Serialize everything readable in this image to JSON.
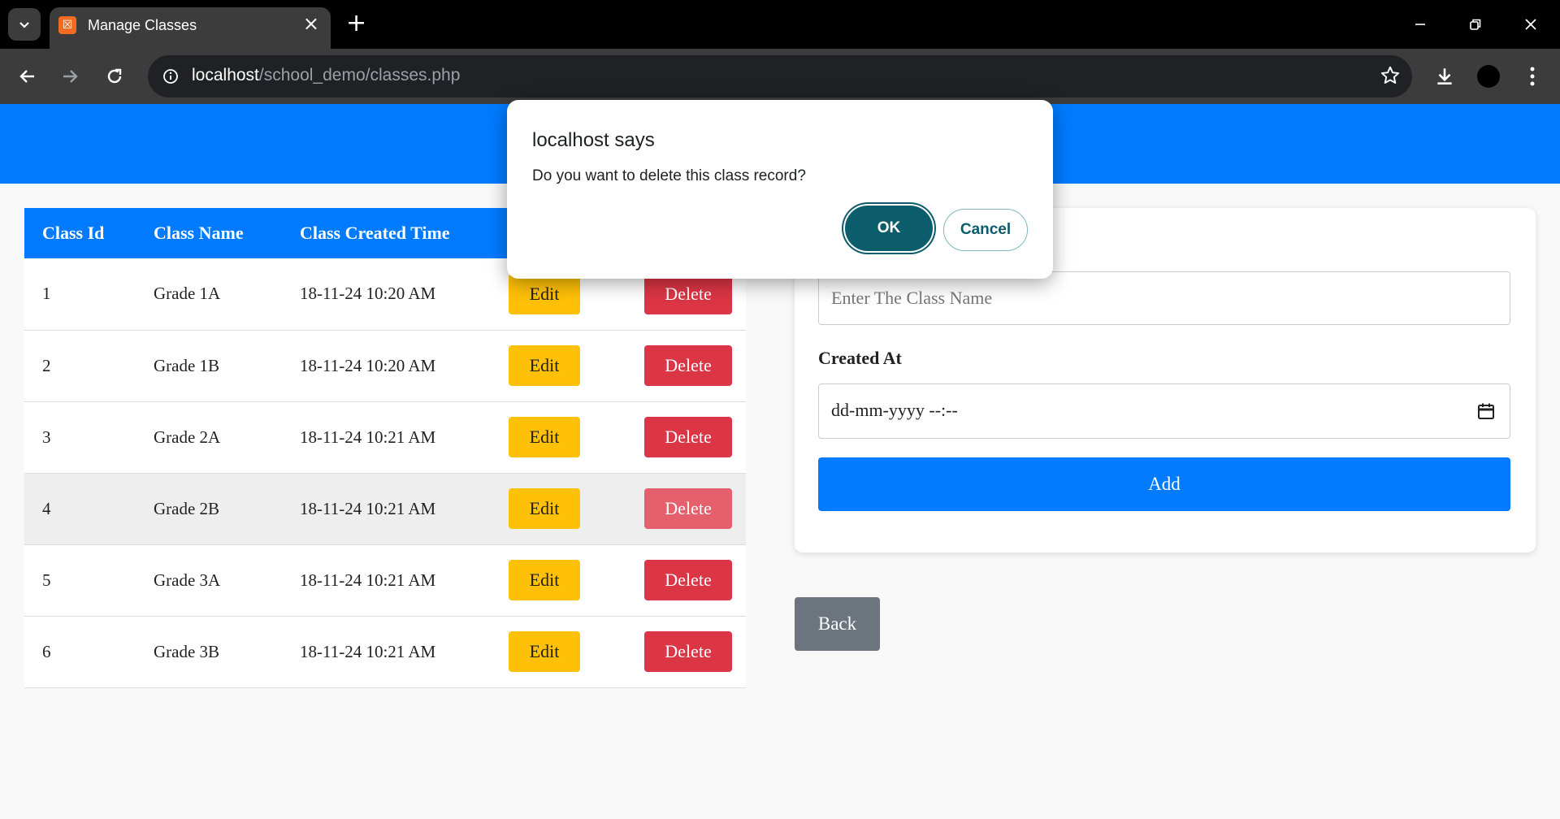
{
  "browser": {
    "tab_title": "Manage Classes",
    "url_host": "localhost",
    "url_path": "/school_demo/classes.php"
  },
  "table": {
    "headers": [
      "Class Id",
      "Class Name",
      "Class Created Time"
    ],
    "rows": [
      {
        "id": "1",
        "name": "Grade 1A",
        "created": "18-11-24 10:20 AM",
        "edit": "Edit",
        "delete": "Delete"
      },
      {
        "id": "2",
        "name": "Grade 1B",
        "created": "18-11-24 10:20 AM",
        "edit": "Edit",
        "delete": "Delete"
      },
      {
        "id": "3",
        "name": "Grade 2A",
        "created": "18-11-24 10:21 AM",
        "edit": "Edit",
        "delete": "Delete"
      },
      {
        "id": "4",
        "name": "Grade 2B",
        "created": "18-11-24 10:21 AM",
        "edit": "Edit",
        "delete": "Delete"
      },
      {
        "id": "5",
        "name": "Grade 3A",
        "created": "18-11-24 10:21 AM",
        "edit": "Edit",
        "delete": "Delete"
      },
      {
        "id": "6",
        "name": "Grade 3B",
        "created": "18-11-24 10:21 AM",
        "edit": "Edit",
        "delete": "Delete"
      }
    ]
  },
  "form": {
    "class_name_placeholder": "Enter The Class Name",
    "created_label": "Created At",
    "date_placeholder": "dd-mm-yyyy --:--",
    "add_label": "Add"
  },
  "back_label": "Back",
  "dialog": {
    "title": "localhost says",
    "message": "Do you want to delete this class record?",
    "ok_label": "OK",
    "cancel_label": "Cancel"
  },
  "colors": {
    "primary": "#007bff",
    "warning": "#ffc107",
    "danger": "#dc3545",
    "secondary": "#6c757d",
    "dialog_accent": "#0b5d6b"
  },
  "icons": [
    "tab-list-icon",
    "xampp-favicon",
    "close-tab-icon",
    "new-tab-icon",
    "minimize-icon",
    "restore-icon",
    "close-window-icon",
    "back-arrow-icon",
    "forward-arrow-icon",
    "reload-icon",
    "site-info-icon",
    "bookmark-star-icon",
    "download-icon",
    "profile-avatar",
    "kebab-menu-icon",
    "calendar-icon",
    "scroll-down-arrow-icon"
  ]
}
